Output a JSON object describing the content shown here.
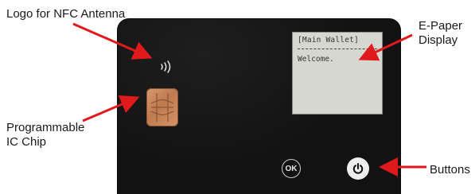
{
  "labels": {
    "nfc_antenna": "Logo for NFC Antenna",
    "epaper_display": "E-Paper\nDisplay",
    "ic_chip": "Programmable\nIC Chip",
    "buttons": "Buttons"
  },
  "epaper": {
    "header": "[Main Wallet]",
    "message": "Welcome."
  },
  "buttons": {
    "ok_label": "OK",
    "power_icon": "power-icon"
  },
  "colors": {
    "card": "#121212",
    "arrow": "#e0191d",
    "epaper": "#d7d7d2",
    "chip": "#c8855a"
  }
}
